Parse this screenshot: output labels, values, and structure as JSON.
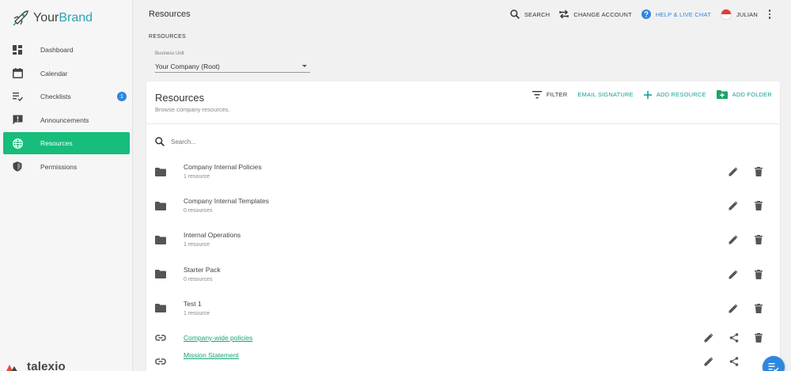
{
  "brand": {
    "name_part1": "Your",
    "name_part2": "Brand"
  },
  "nav": [
    {
      "label": "Dashboard",
      "icon": "dashboard-icon"
    },
    {
      "label": "Calendar",
      "icon": "calendar-icon"
    },
    {
      "label": "Checklists",
      "icon": "checklist-icon",
      "badge": "1"
    },
    {
      "label": "Announcements",
      "icon": "announcement-icon"
    },
    {
      "label": "Resources",
      "icon": "globe-icon",
      "active": true
    },
    {
      "label": "Permissions",
      "icon": "shield-icon"
    }
  ],
  "footer": {
    "name": "talexio"
  },
  "topbar": {
    "title": "Resources",
    "search": "SEARCH",
    "change_account": "CHANGE ACCOUNT",
    "help": "HELP & LIVE CHAT",
    "user": "JULIAN"
  },
  "filters": {
    "section_label": "RESOURCES",
    "business_unit_label": "Business Unit",
    "business_unit_value": "Your Company (Root)"
  },
  "card": {
    "title": "Resources",
    "subtitle": "Browse company resources.",
    "filter": "FILTER",
    "email_signature": "EMAIL SIGNATURE",
    "add_resource": "ADD RESOURCE",
    "add_folder": "ADD FOLDER",
    "search_placeholder": "Search..."
  },
  "rows": [
    {
      "type": "folder",
      "title": "Company Internal Policies",
      "sub": "1 resource"
    },
    {
      "type": "folder",
      "title": "Company Internal Templates",
      "sub": "0 resources"
    },
    {
      "type": "folder",
      "title": "Internal Operations",
      "sub": "1 resource"
    },
    {
      "type": "folder",
      "title": "Starter Pack",
      "sub": "0 resources"
    },
    {
      "type": "folder",
      "title": "Test 1",
      "sub": "1 resource"
    },
    {
      "type": "link",
      "title": "Company-wide policies"
    },
    {
      "type": "link",
      "title": "Mission Statement"
    }
  ],
  "colors": {
    "accent": "#17bd7b",
    "link": "#1aa37a",
    "teal": "#1a9e93",
    "blue": "#2e86de"
  }
}
